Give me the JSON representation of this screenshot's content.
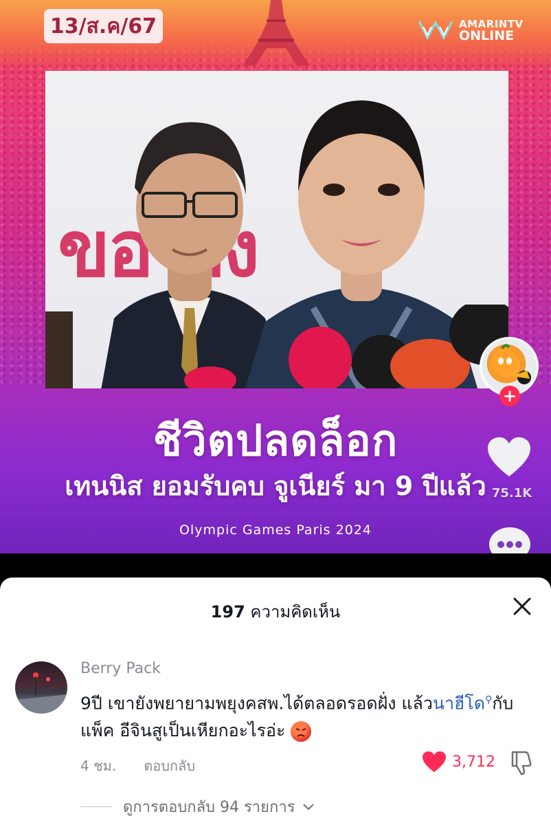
{
  "video": {
    "date_label": "13/ส.ค/67",
    "brand": {
      "line1": "AMARINTV",
      "line2": "ONLINE"
    },
    "backdrop_text": "ขอ   ดง",
    "title_main": "ชีวิตปลดล็อก",
    "title_sub": "เทนนิส ยอมรับคบ จูเนียร์ มา 9 ปีแล้ว",
    "title_tag": "Olympic Games Paris 2024",
    "like_count": "75.1K"
  },
  "sheet": {
    "comment_count": "197",
    "comment_count_label": "ความคิดเห็น"
  },
  "comment": {
    "user": "Berry Pack",
    "text_before": "9ปี เขายังพยายามพยุงคสพ.ได้ตลอดรอดฝั่ง แล้ว",
    "mention": "นาฮีโด",
    "text_after": "กับแพ็ค อีจินสูเป็นเหียกอะไรอ่ะ",
    "time": "4 ชม.",
    "reply_label": "ตอบกลับ",
    "like_count": "3,712",
    "view_replies": "ดูการตอบกลับ 94 รายการ"
  },
  "colors": {
    "accent_red": "#fe2c55",
    "mention_blue": "#2b5db9",
    "text_dark": "#161823",
    "text_gray": "#8a8b91"
  },
  "icons": [
    "amarin-logo-icon",
    "heart-icon",
    "comment-dots-icon",
    "close-icon",
    "search-icon",
    "angry-emoji-icon",
    "dislike-icon",
    "chevron-down-icon",
    "plus-icon"
  ]
}
